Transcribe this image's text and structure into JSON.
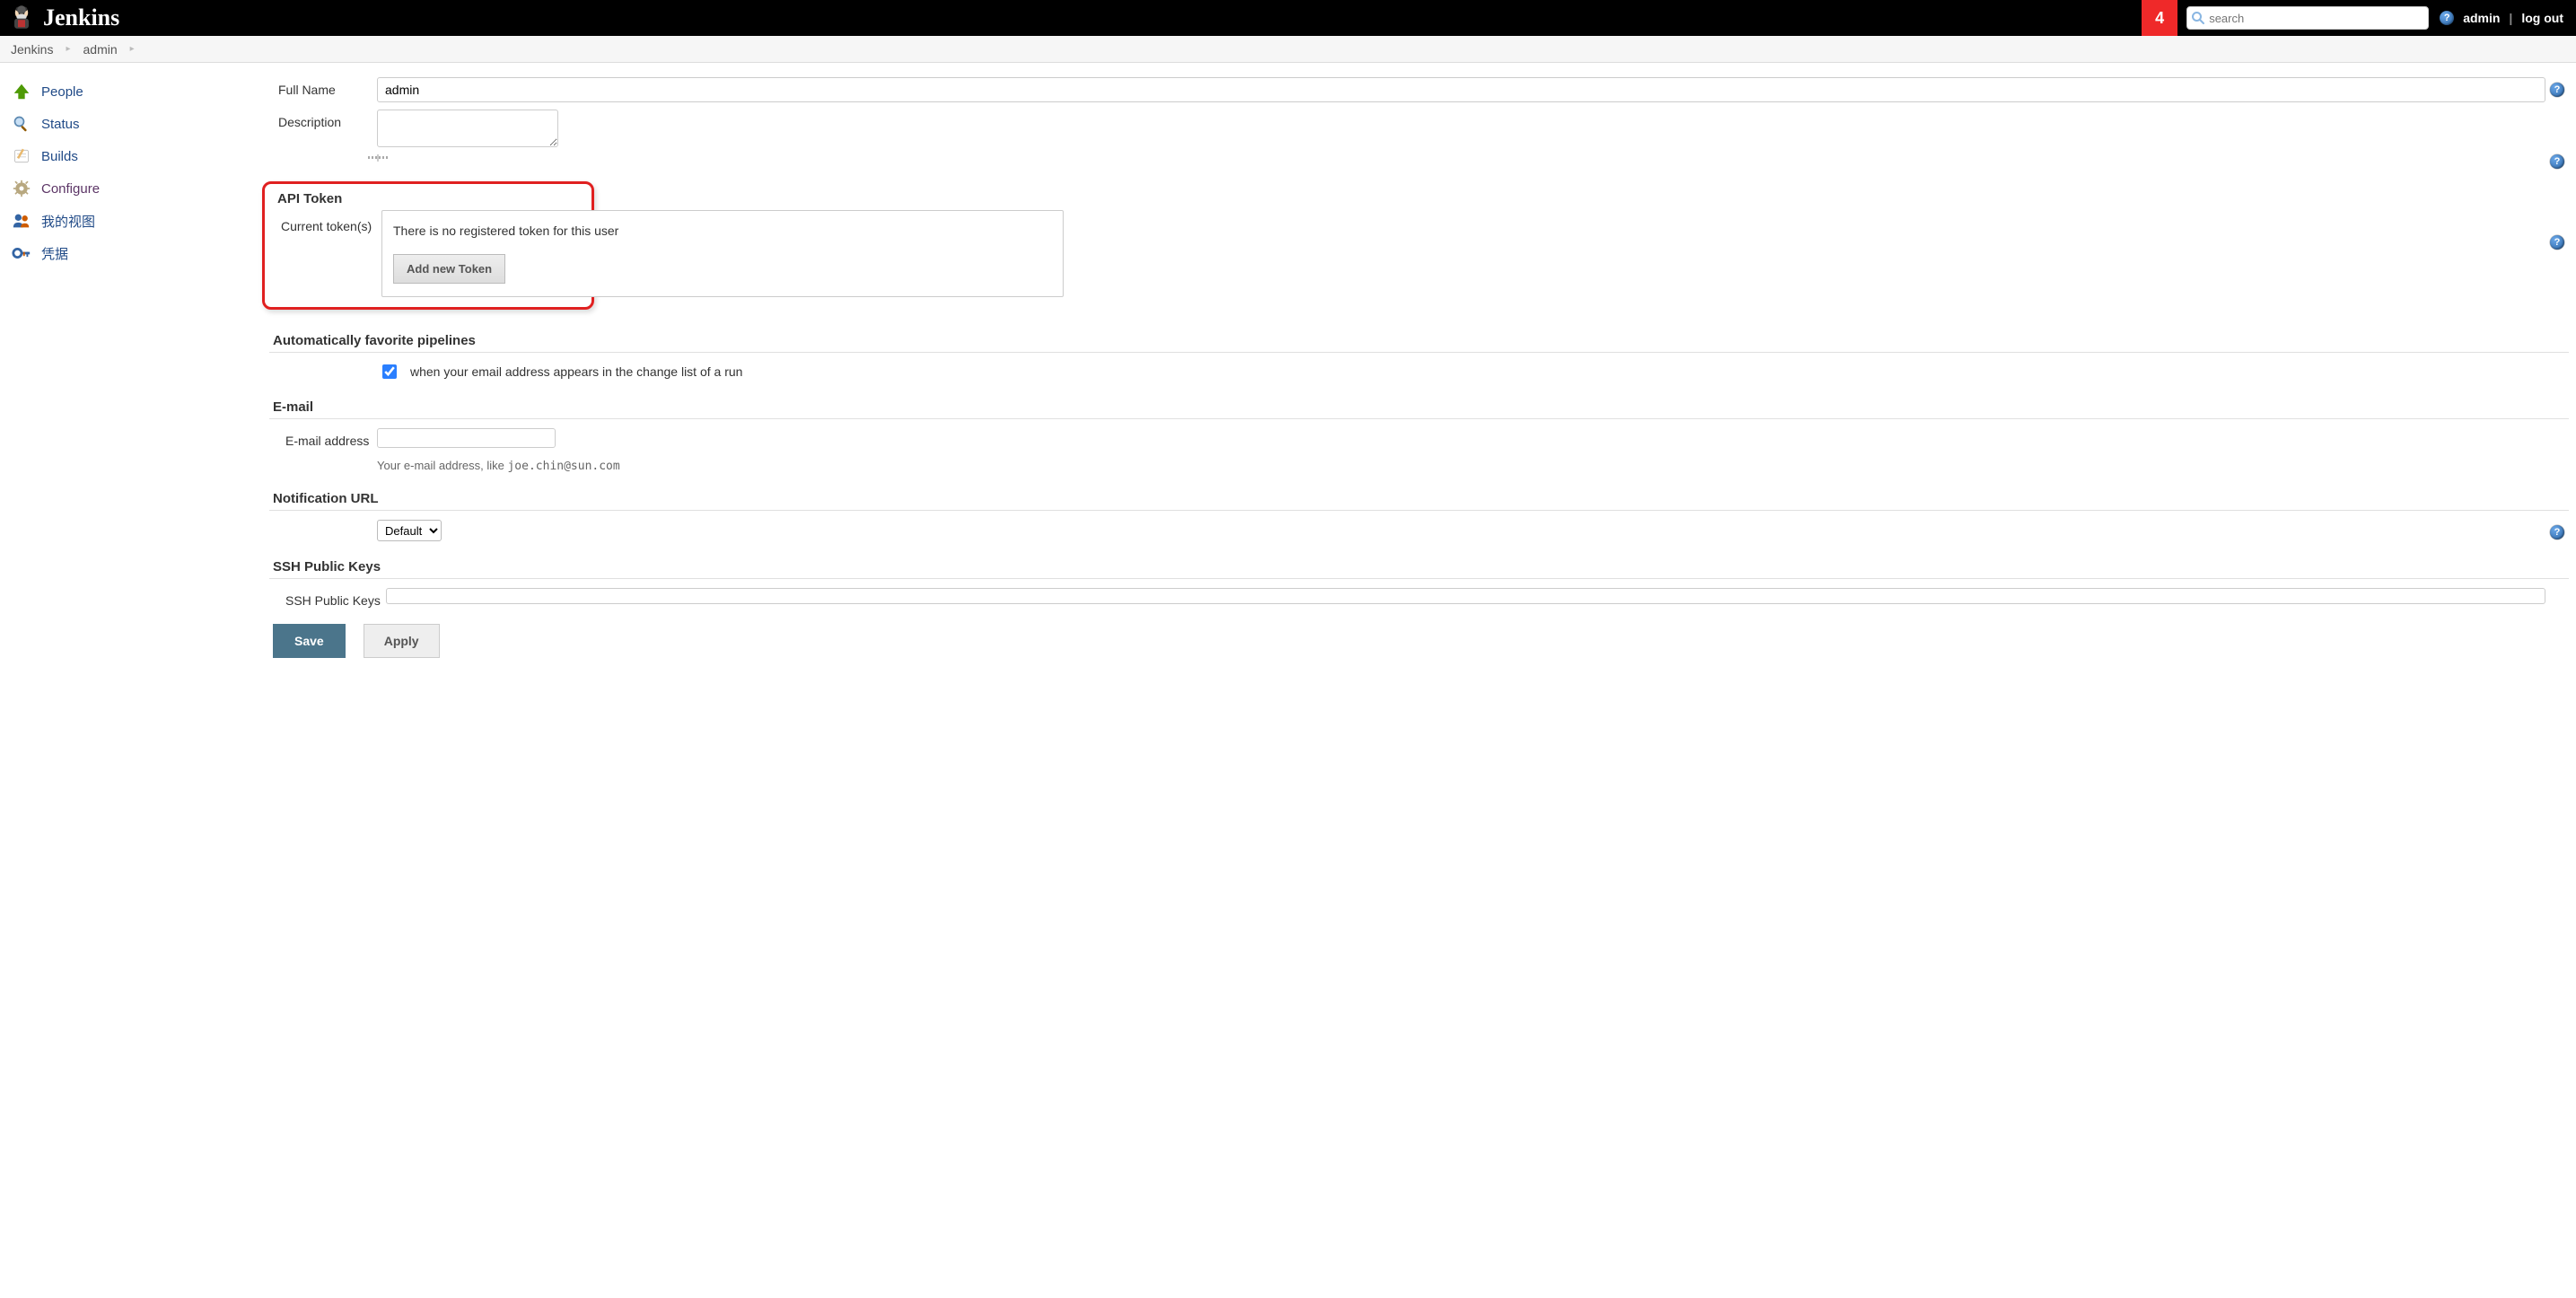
{
  "header": {
    "logo_text": "Jenkins",
    "badge_count": "4",
    "search_placeholder": "search",
    "user": "admin",
    "logout": "log out"
  },
  "breadcrumb": {
    "root": "Jenkins",
    "user": "admin"
  },
  "sidebar": {
    "items": [
      {
        "label": "People"
      },
      {
        "label": "Status"
      },
      {
        "label": "Builds"
      },
      {
        "label": "Configure"
      },
      {
        "label": "我的视图"
      },
      {
        "label": "凭据"
      }
    ]
  },
  "form": {
    "full_name_label": "Full Name",
    "full_name_value": "admin",
    "description_label": "Description",
    "description_value": "",
    "api_token_heading": "API Token",
    "current_tokens_label": "Current token(s)",
    "no_token_msg": "There is no registered token for this user",
    "add_token_btn": "Add new Token",
    "auto_fav_heading": "Automatically favorite pipelines",
    "auto_fav_label": "when your email address appears in the change list of a run",
    "email_heading": "E-mail",
    "email_label": "E-mail address",
    "email_value": "",
    "email_hint_prefix": "Your e-mail address, like ",
    "email_hint_example": "joe.chin@sun.com",
    "notif_heading": "Notification URL",
    "notif_selected": "Default",
    "ssh_heading": "SSH Public Keys",
    "ssh_label": "SSH Public Keys",
    "save_btn": "Save",
    "apply_btn": "Apply"
  }
}
